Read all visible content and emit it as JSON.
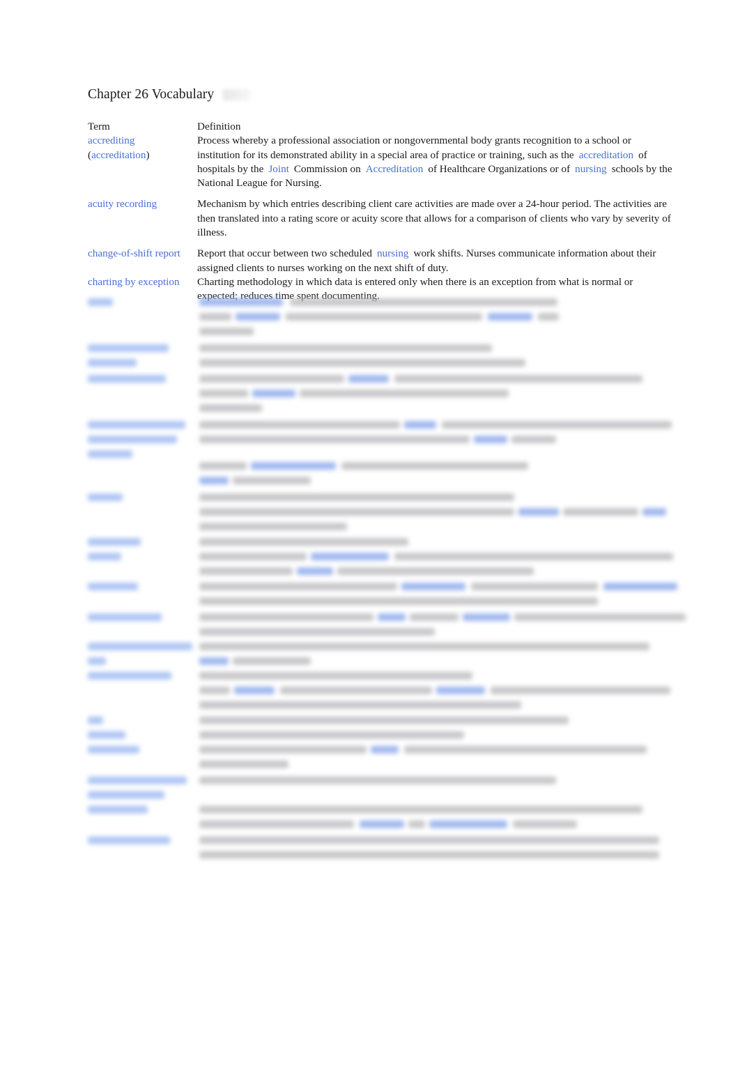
{
  "document": {
    "title": "Chapter 26 Vocabulary",
    "columns": {
      "term_header": "Term",
      "definition_header": "Definition"
    },
    "colors": {
      "link_blue": "#4a6fd4",
      "body_text": "#1a1a1a",
      "page_background": "#ffffff",
      "blurred_text": "#b9b9bb",
      "blurred_link": "#93aeec"
    },
    "entries": [
      {
        "term_parts": [
          {
            "text": "accrediting",
            "style": "link"
          },
          {
            "text": "(",
            "style": "plain"
          },
          {
            "text": "accreditation",
            "style": "link"
          },
          {
            "text": ")",
            "style": "plain"
          }
        ],
        "term_plain": "accrediting (accreditation)",
        "definition_parts": [
          {
            "text": "Process whereby a professional association or nongovernmental body grants recognition to a school or institution for its demonstrated ability in a special area of practice or training, such as the",
            "style": "plain"
          },
          {
            "text": "accreditation",
            "style": "link"
          },
          {
            "text": "of hospitals by the",
            "style": "plain"
          },
          {
            "text": "Joint",
            "style": "link"
          },
          {
            "text": "Commission on",
            "style": "plain"
          },
          {
            "text": "Accreditation",
            "style": "link"
          },
          {
            "text": "of Healthcare Organizations or of",
            "style": "plain"
          },
          {
            "text": "nursing",
            "style": "link"
          },
          {
            "text": "schools by the National League for Nursing.",
            "style": "plain"
          }
        ]
      },
      {
        "term_parts": [
          {
            "text": "acuity recording",
            "style": "link"
          }
        ],
        "term_plain": "acuity recording",
        "definition_parts": [
          {
            "text": "Mechanism by which entries describing client care activities are made over a 24-hour period. The activities are then translated into a rating score or acuity score that allows for a comparison of clients who vary by severity of illness.",
            "style": "plain"
          }
        ]
      },
      {
        "term_parts": [
          {
            "text": "change-of-shift report",
            "style": "link"
          }
        ],
        "term_plain": "change-of-shift report",
        "definition_parts": [
          {
            "text": "Report that occur between two scheduled",
            "style": "plain"
          },
          {
            "text": "nursing",
            "style": "link"
          },
          {
            "text": "work shifts. Nurses communicate information about their assigned clients to nurses working on the next shift of duty.",
            "style": "plain"
          }
        ]
      },
      {
        "term_parts": [
          {
            "text": "charting by exception",
            "style": "link"
          }
        ],
        "term_plain": "charting by exception",
        "definition_parts": [
          {
            "text": "Charting methodology in which data is entered only when there is an exception from what is normal or expected; reduces time spent documenting.",
            "style": "plain"
          }
        ]
      }
    ],
    "redacted_section": {
      "note": "Lower portion of the vocabulary list is blurred and illegible in the screenshot.",
      "legible": false
    }
  }
}
